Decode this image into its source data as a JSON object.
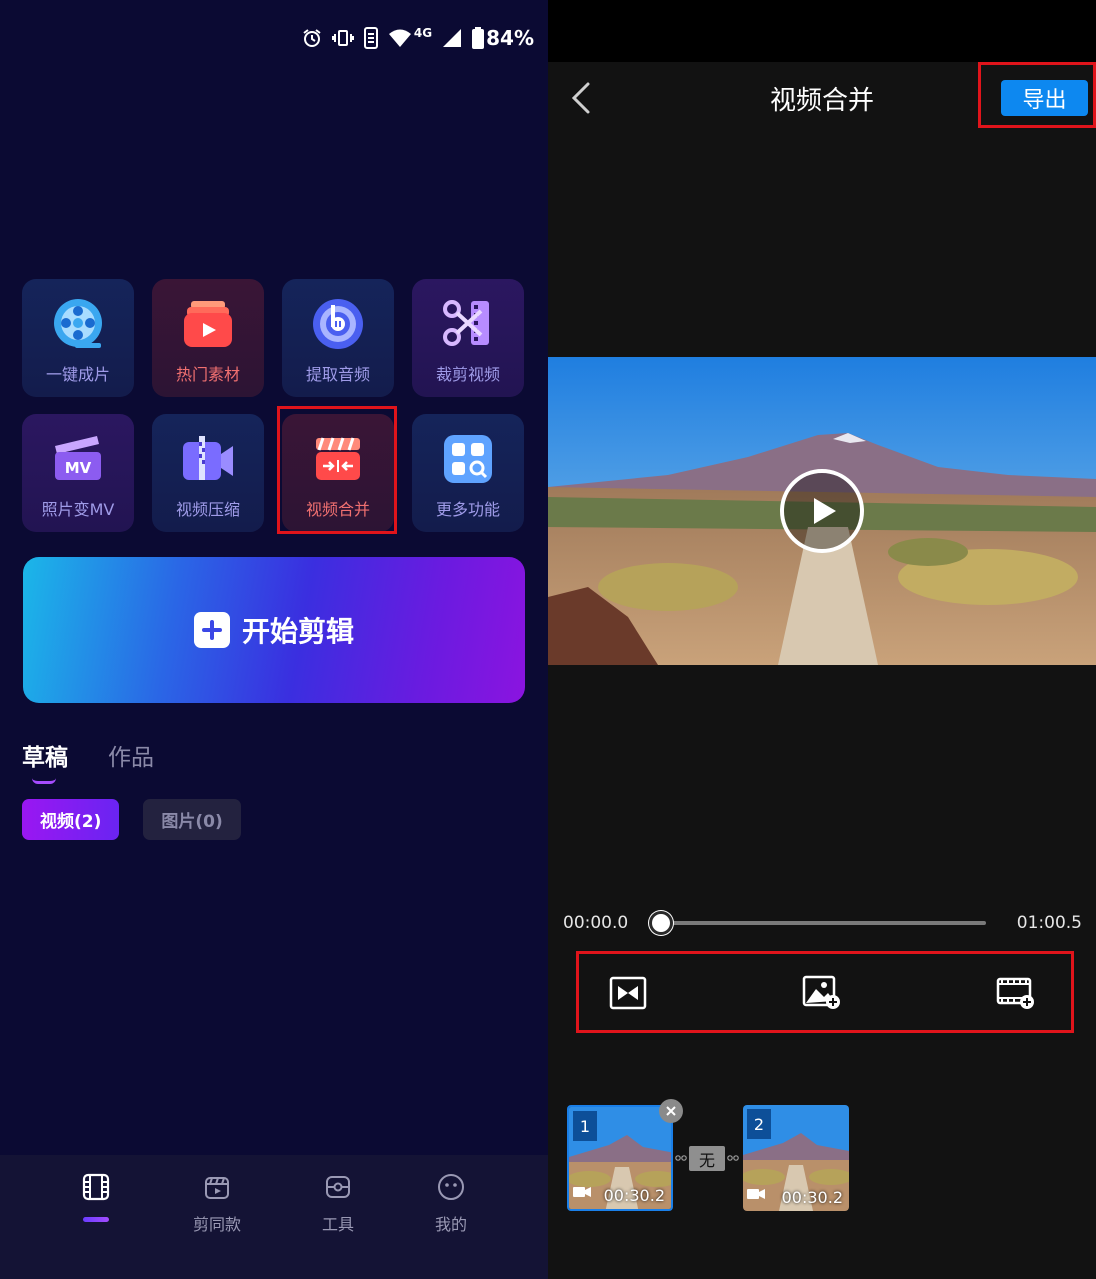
{
  "status_bar": {
    "network": "4G",
    "battery": "84%",
    "icons": [
      "alarm-icon",
      "vibrate-icon",
      "data-saver-icon",
      "wifi-icon",
      "signal-icon",
      "battery-icon"
    ]
  },
  "home": {
    "tiles": [
      {
        "label": "一键成片",
        "icon": "film-reel-icon"
      },
      {
        "label": "热门素材",
        "icon": "hot-material-icon"
      },
      {
        "label": "提取音频",
        "icon": "extract-audio-icon"
      },
      {
        "label": "裁剪视频",
        "icon": "cut-video-icon"
      },
      {
        "label": "照片变MV",
        "icon": "photo-mv-icon"
      },
      {
        "label": "视频压缩",
        "icon": "compress-video-icon"
      },
      {
        "label": "视频合并",
        "icon": "merge-video-icon"
      },
      {
        "label": "更多功能",
        "icon": "more-functions-icon"
      }
    ],
    "start_button": "开始剪辑",
    "tabs": {
      "drafts": "草稿",
      "works": "作品"
    },
    "chips": {
      "video": "视频(2)",
      "image": "图片(0)"
    },
    "nav": {
      "home_icon": "film-strip-icon",
      "templates": "剪同款",
      "tools": "工具",
      "mine": "我的"
    },
    "colors": {
      "highlight": "#e0141b",
      "accent": "#9a17f2",
      "background": "#0b0a33"
    }
  },
  "merge": {
    "title": "视频合并",
    "export_label": "导出",
    "time_start": "00:00.0",
    "time_end": "01:00.5",
    "playhead_fraction": 0.0,
    "tools": [
      "transition-icon",
      "add-image-icon",
      "add-clip-icon"
    ],
    "clips": [
      {
        "index": "1",
        "duration": "00:30.2"
      },
      {
        "index": "2",
        "duration": "00:30.2"
      }
    ],
    "transition_label": "无",
    "colors": {
      "export": "#0d88f0",
      "background": "#121212"
    }
  }
}
